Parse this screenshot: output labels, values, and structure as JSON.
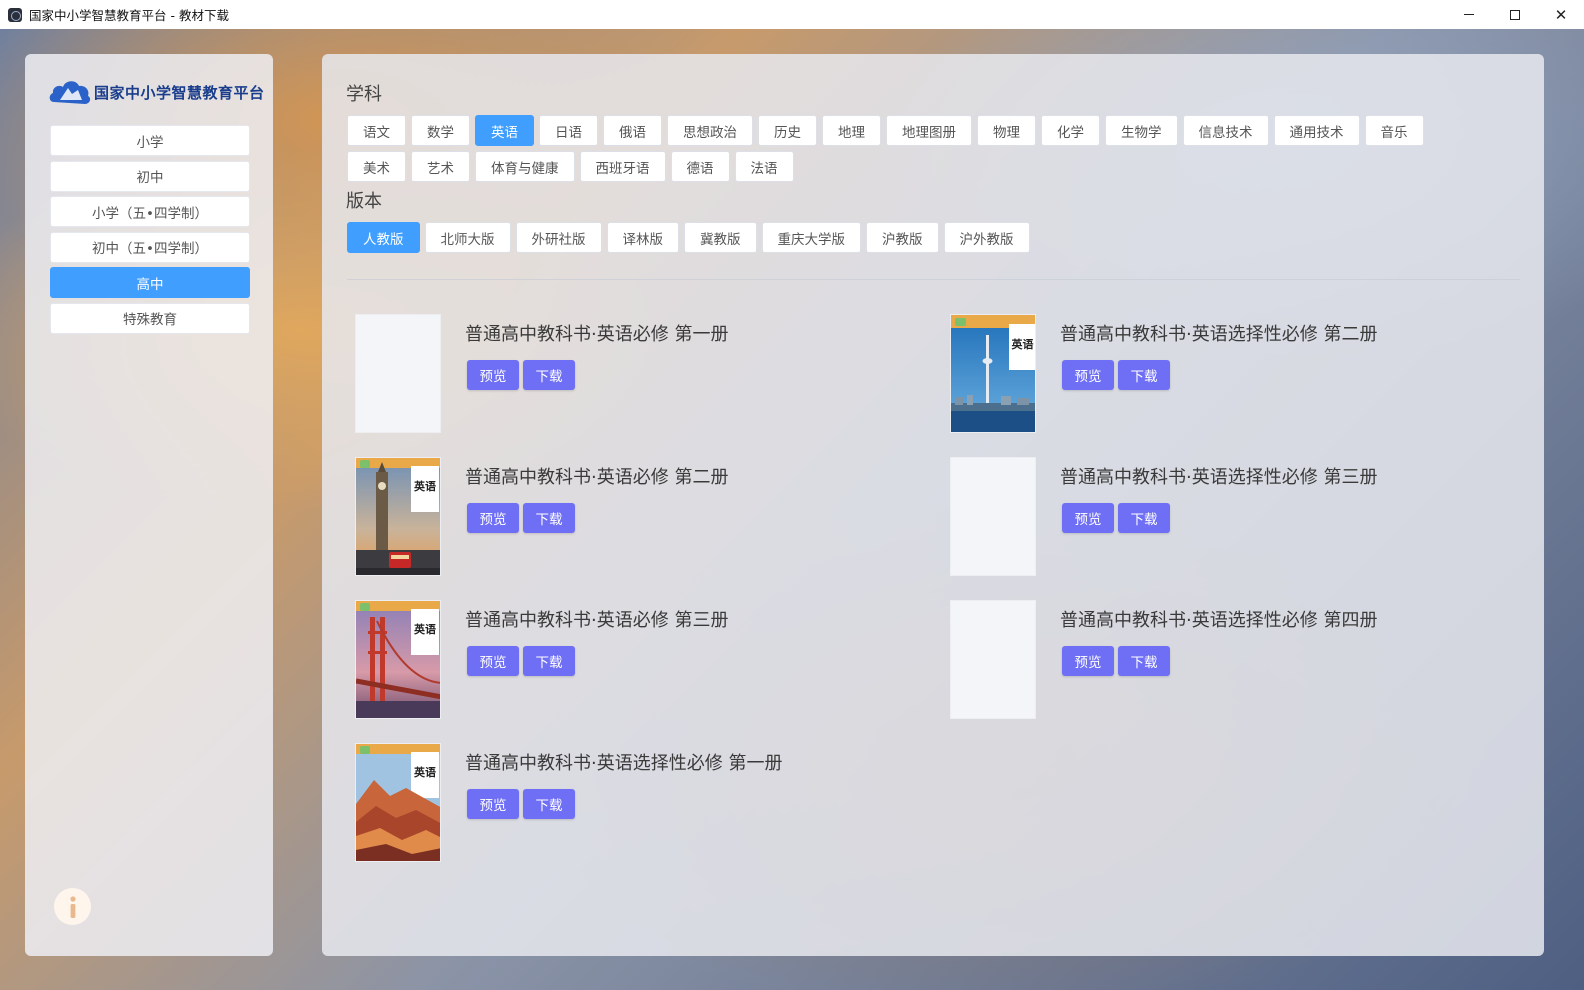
{
  "window": {
    "title": "国家中小学智慧教育平台 - 教材下载",
    "minimize": "—",
    "maximize": "☐",
    "close": "✕"
  },
  "sidebar": {
    "logo_text": "国家中小学智慧教育平台",
    "levels": [
      {
        "label": "小学"
      },
      {
        "label": "初中"
      },
      {
        "label": "小学（五•四学制）"
      },
      {
        "label": "初中（五•四学制）"
      },
      {
        "label": "高中",
        "active": true
      },
      {
        "label": "特殊教育"
      }
    ],
    "info_icon": "info-icon"
  },
  "main": {
    "subject_title": "学科",
    "subjects": [
      {
        "label": "语文"
      },
      {
        "label": "数学"
      },
      {
        "label": "英语",
        "active": true
      },
      {
        "label": "日语"
      },
      {
        "label": "俄语"
      },
      {
        "label": "思想政治"
      },
      {
        "label": "历史"
      },
      {
        "label": "地理"
      },
      {
        "label": "地理图册"
      },
      {
        "label": "物理"
      },
      {
        "label": "化学"
      },
      {
        "label": "生物学"
      },
      {
        "label": "信息技术"
      },
      {
        "label": "通用技术"
      },
      {
        "label": "音乐"
      },
      {
        "label": "美术"
      },
      {
        "label": "艺术"
      },
      {
        "label": "体育与健康"
      },
      {
        "label": "西班牙语"
      },
      {
        "label": "德语"
      },
      {
        "label": "法语"
      }
    ],
    "edition_title": "版本",
    "editions": [
      {
        "label": "人教版",
        "active": true
      },
      {
        "label": "北师大版"
      },
      {
        "label": "外研社版"
      },
      {
        "label": "译林版"
      },
      {
        "label": "冀教版"
      },
      {
        "label": "重庆大学版"
      },
      {
        "label": "沪教版"
      },
      {
        "label": "沪外教版"
      }
    ],
    "preview_label": "预览",
    "download_label": "下载",
    "books": [
      {
        "title": "普通高中教科书·英语必修 第一册",
        "cover": "blank"
      },
      {
        "title": "普通高中教科书·英语选择性必修 第二册",
        "cover": "tower",
        "cover_text": "英语"
      },
      {
        "title": "普通高中教科书·英语必修 第二册",
        "cover": "bigben",
        "cover_text": "英语"
      },
      {
        "title": "普通高中教科书·英语选择性必修 第三册",
        "cover": "blank"
      },
      {
        "title": "普通高中教科书·英语必修 第三册",
        "cover": "bridge",
        "cover_text": "英语"
      },
      {
        "title": "普通高中教科书·英语选择性必修 第四册",
        "cover": "blank"
      },
      {
        "title": "普通高中教科书·英语选择性必修 第一册",
        "cover": "mountain",
        "cover_text": "英语"
      }
    ]
  },
  "colors": {
    "accent": "#409eff",
    "action_button": "#6f6ff5"
  }
}
